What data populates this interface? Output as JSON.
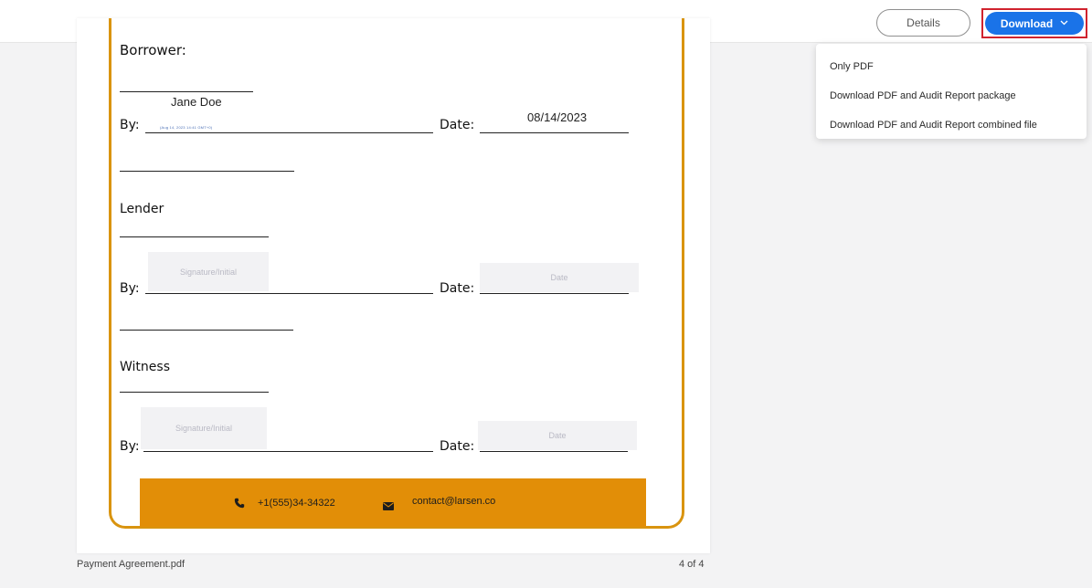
{
  "toolbar": {
    "details_label": "Details",
    "download_label": "Download"
  },
  "download_menu": {
    "items": [
      {
        "label": "Only PDF"
      },
      {
        "label": "Download PDF and Audit Report package"
      },
      {
        "label": "Download PDF and Audit Report combined file"
      }
    ]
  },
  "document": {
    "borrower": {
      "heading": "Borrower:",
      "name": "Jane Doe",
      "by_label": "By:",
      "signature_stamp": "(Aug 14, 2023 14:41 GMT+0)",
      "date_label": "Date:",
      "date_value": "08/14/2023"
    },
    "lender": {
      "heading": "Lender",
      "by_label": "By:",
      "signature_placeholder": "Signature/Initial",
      "date_label": "Date:",
      "date_placeholder": "Date"
    },
    "witness": {
      "heading": "Witness",
      "by_label": "By:",
      "signature_placeholder": "Signature/Initial",
      "date_label": "Date:",
      "date_placeholder": "Date"
    },
    "footer": {
      "phone": "+1(555)34-34322",
      "email": "contact@larsen.co"
    }
  },
  "statusbar": {
    "filename": "Payment Agreement.pdf",
    "page_indicator": "4 of 4"
  },
  "colors": {
    "accent": "#1a73e8",
    "frame": "#d9940f",
    "footer_band": "#e28e07",
    "highlight_border": "#d0232e"
  }
}
